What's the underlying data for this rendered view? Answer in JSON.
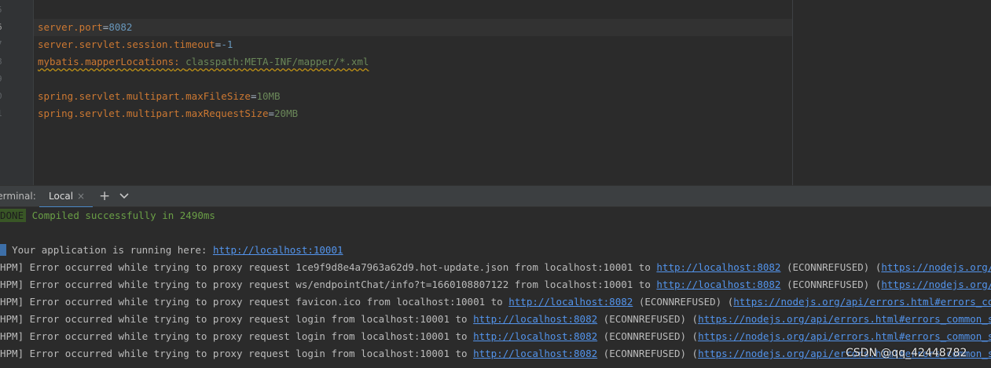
{
  "editor": {
    "line_numbers": [
      "5",
      "6",
      "7",
      "8",
      "9",
      "0",
      "1"
    ],
    "lines": [
      {
        "key": "server.port",
        "op": "=",
        "value": "8082",
        "value_type": "num"
      },
      {
        "key": "server.servlet.session.timeout",
        "op": "=",
        "value": "-1",
        "value_type": "num"
      },
      {
        "key": "mybatis.mapperLocations",
        "op": ": ",
        "value": "classpath:META-INF/mapper/*.xml",
        "value_type": "str"
      },
      {
        "key": "spring.servlet.multipart.maxFileSize",
        "op": "=",
        "value": "10MB",
        "value_type": "str"
      },
      {
        "key": "spring.servlet.multipart.maxRequestSize",
        "op": "=",
        "value": "20MB",
        "value_type": "str"
      }
    ]
  },
  "terminal": {
    "title": "Terminal:",
    "tab_label": "Local",
    "close_glyph": "×",
    "add_glyph": "+",
    "done_badge": "DONE",
    "compiled_msg": "Compiled successfully in 2490ms",
    "info_badge": "I",
    "running_msg": "Your application is running here: ",
    "running_url": "http://localhost:10001",
    "hpm_prefix": "HPM]",
    "err_prefix": " Error occurred while trying to proxy request ",
    "from_text": " from localhost:10001 to ",
    "target_url": "http://localhost:8082",
    "econn": " (ECONNREFUSED) (",
    "errors": [
      {
        "request": "1ce9f9d8e4a7963a62d9.hot-update.json",
        "doc_url": "https://nodejs.org/api/errors.html#errors_common_system_errors"
      },
      {
        "request": "ws/endpointChat/info?t=1660108807122",
        "doc_url": "https://nodejs.org/api/errors.html#errors_common_system_errors"
      },
      {
        "request": "favicon.ico",
        "doc_url": "https://nodejs.org/api/errors.html#errors_common_system_errors"
      },
      {
        "request": "login",
        "doc_url": "https://nodejs.org/api/errors.html#errors_common_system_errors"
      },
      {
        "request": "login",
        "doc_url": "https://nodejs.org/api/errors.html#errors_common_system_errors"
      },
      {
        "request": "login",
        "doc_url": "https://nodejs.org/api/errors.html#errors_common_system_errors"
      }
    ]
  },
  "watermark": "CSDN @qq_42448782",
  "colors": {
    "editor_bg": "#2b2b2b",
    "keyword": "#cc7832",
    "number": "#6897bb",
    "string": "#6a8759",
    "link": "#5394ec",
    "success": "#6a9f46"
  }
}
